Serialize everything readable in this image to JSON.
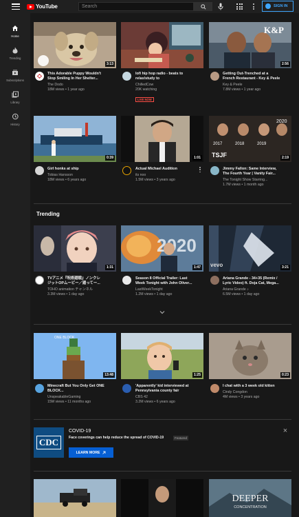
{
  "header": {
    "logo_text": "YouTube",
    "search_placeholder": "Search",
    "signin_label": "SIGN IN"
  },
  "sidebar": {
    "items": [
      {
        "label": "Home",
        "icon": "home-icon"
      },
      {
        "label": "Trending",
        "icon": "flame-icon"
      },
      {
        "label": "Subscriptions",
        "icon": "subscriptions-icon"
      },
      {
        "label": "Library",
        "icon": "library-icon"
      },
      {
        "label": "History",
        "icon": "history-icon"
      }
    ]
  },
  "home": {
    "row1": [
      {
        "title_line1": "This Adorable Puppy Wouldn't",
        "title_line2": "Stop Smiling In Her Shelter...",
        "channel": "The Dodo",
        "meta": "18M views • 1 year ago",
        "duration": "3:13"
      },
      {
        "title_line1": "lofi hip hop radio - beats to",
        "title_line2": "relax/study to",
        "channel": "ChilledCow",
        "meta": "20K watching",
        "live": "LIVE NOW"
      },
      {
        "title_line1": "Getting Out-Trenched at a",
        "title_line2": "French Restaurant - Key & Peele",
        "channel": "Key & Peele",
        "meta": "7.8M views • 1 year ago",
        "duration": "2:56"
      }
    ],
    "row2": [
      {
        "title_line1": "Girl honks at ship",
        "title_line2": "",
        "channel": "Tobias Hansson",
        "meta": "18M views • 6 years ago",
        "duration": "0:39"
      },
      {
        "title_line1": "Actual Michael Audition",
        "title_line2": "",
        "channel": "its noo",
        "meta": "1.5M views • 3 years ago",
        "duration": "1:01"
      },
      {
        "title_line1": "Jimmy Fallon: Same Interview,",
        "title_line2": "The Fourth Year | Vanity Fair...",
        "channel": "The Tonight Show Starring...",
        "meta": "1.7M views • 1 month ago",
        "duration": "2:19"
      }
    ]
  },
  "trending": {
    "title": "Trending",
    "items": [
      {
        "title_line1": "TVアニメ『呪術廻戦』ノンクレ",
        "title_line2": "ジットOPムービー／廻ってー...",
        "channel": "TOHO animation チャンネル",
        "meta": "3.3M views • 1 day ago",
        "duration": "1:31"
      },
      {
        "title_line1": "Season 8 Official Trailer: Last",
        "title_line2": "Week Tonight with John Oliver...",
        "channel": "LastWeekTonight",
        "meta": "1.2M views • 1 day ago",
        "duration": "1:47"
      },
      {
        "title_line1": "Ariana Grande - 34+35 (Remix /",
        "title_line2": "Lyric Video) ft. Doja Cat, Mega...",
        "channel": "Ariana Grande ♪",
        "meta": "6.5M views • 1 day ago",
        "duration": "3:21"
      }
    ]
  },
  "row3": [
    {
      "title_line1": "Minecraft But You Only Get ONE",
      "title_line2": "BLOCK...",
      "channel": "UnspeakableGaming",
      "meta": "15M views • 11 months ago",
      "duration": "13:48"
    },
    {
      "title_line1": "'Apparently' kid interviewed at",
      "title_line2": "Pennsylvania county fair",
      "channel": "CBS 42",
      "meta": "3.2M views • 6 years ago",
      "duration": "1:25"
    },
    {
      "title_line1": "I chat with a 3 week old kitten",
      "title_line2": "",
      "channel": "Cindy Congdon",
      "meta": "4M views • 3 years ago",
      "duration": "0:23"
    }
  ],
  "covid": {
    "logo_text": "CDC",
    "title": "COVID-19",
    "desc": "Face coverings can help reduce the spread of COVID-19",
    "badge": "Featured",
    "button": "LEARN MORE"
  },
  "bottom": {
    "deeper_line1": "DEEPER",
    "deeper_line2": "CONCENTRATION"
  },
  "colors": {
    "brand_red": "#ff0000",
    "accent_blue": "#3ea6ff",
    "live_red": "#ff4e45",
    "cdc_blue": "#0f4c81"
  }
}
